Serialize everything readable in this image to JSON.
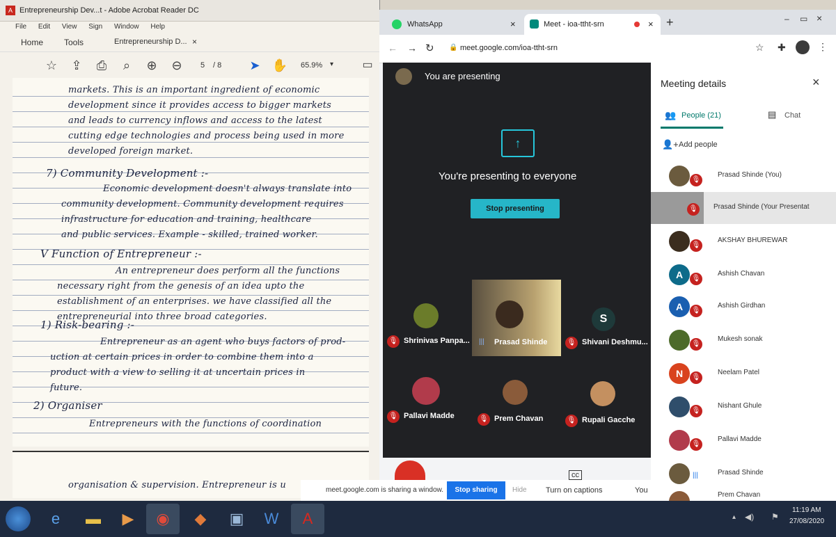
{
  "acrobat": {
    "title": "Entrepreneurship Dev...t - Adobe Acrobat Reader DC",
    "menu": [
      "File",
      "Edit",
      "View",
      "Sign",
      "Window",
      "Help"
    ],
    "tabs": {
      "home": "Home",
      "tools": "Tools",
      "doc": "Entrepreneurship D..."
    },
    "page_current": "5",
    "page_total": "/ 8",
    "zoom": "65.9%",
    "lines": [
      "markets. This is an important ingredient of economic",
      "development since it provides access to bigger markets",
      "and leads to currency inflows and access to the latest",
      "cutting edge technologies and process being used in more",
      "developed foreign market.",
      "7) Community Development :-",
      "Economic development doesn't always translate into",
      "community development. Community development requires",
      "infrastructure for education and training, healthcare",
      "and public services. Example - skilled, trained worker.",
      "V   Function of Entrepreneur :-",
      "An entrepreneur does perform all the functions",
      "necessary right from the genesis of an idea upto the",
      "establishment of an enterprises. we have classified all the",
      "entrepreneurial into three broad categories.",
      "1)  Risk-bearing :-",
      "Entrepreneur as an agent who buys factors of prod-",
      "uction at certain prices in order to combine them into a",
      "product with a view to selling it at uncertain prices in",
      "future.",
      "2)  Organiser",
      "Entrepreneurs with the functions of coordination"
    ],
    "page2_line": "organisation & supervision. Entrepreneur is u"
  },
  "chrome": {
    "tab1": "WhatsApp",
    "tab2": "Meet - ioa-ttht-srn",
    "url": "meet.google.com/ioa-ttht-srn"
  },
  "meet": {
    "presenting_header": "You are presenting",
    "presenting_everyone": "You're presenting to everyone",
    "stop_presenting": "Stop presenting",
    "tiles": [
      {
        "name": "Shrinivas Panpa..."
      },
      {
        "name": "Prasad Shinde"
      },
      {
        "name": "Shivani Deshmu...",
        "initial": "S"
      },
      {
        "name": "Pallavi Madde"
      },
      {
        "name": "Prem Chavan"
      },
      {
        "name": "Rupali Gacche"
      }
    ],
    "captions": "Turn on captions",
    "you": "You"
  },
  "panel": {
    "title": "Meeting details",
    "people_tab": "People (21)",
    "chat_tab": "Chat",
    "add_people": "Add people",
    "people": [
      {
        "name": "Prasad Shinde (You)",
        "color": "#6b5b3e"
      },
      {
        "name": "Prasad Shinde (Your Presentat",
        "color": "#8a8a8a"
      },
      {
        "name": "AKSHAY BHUREWAR",
        "color": "#3b2d1e"
      },
      {
        "name": "Ashish Chavan",
        "initial": "A",
        "color": "#0d6b8a"
      },
      {
        "name": "Ashish Girdhan",
        "initial": "A",
        "color": "#1a5fb0"
      },
      {
        "name": "Mukesh sonak",
        "color": "#4d6b2a"
      },
      {
        "name": "Neelam Patel",
        "initial": "N",
        "color": "#d9431e"
      },
      {
        "name": "Nishant Ghule",
        "color": "#2f4e6b"
      },
      {
        "name": "Pallavi Madde",
        "color": "#b13b4b"
      },
      {
        "name": "Prasad Shinde",
        "color": "#6b5b3e"
      },
      {
        "name": "Prem Chavan",
        "color": "#8a5b3a"
      }
    ]
  },
  "sharebar": {
    "text": "meet.google.com is sharing a window.",
    "stop": "Stop sharing",
    "hide": "Hide"
  },
  "taskbar": {
    "time": "11:19 AM",
    "date": "27/08/2020"
  }
}
